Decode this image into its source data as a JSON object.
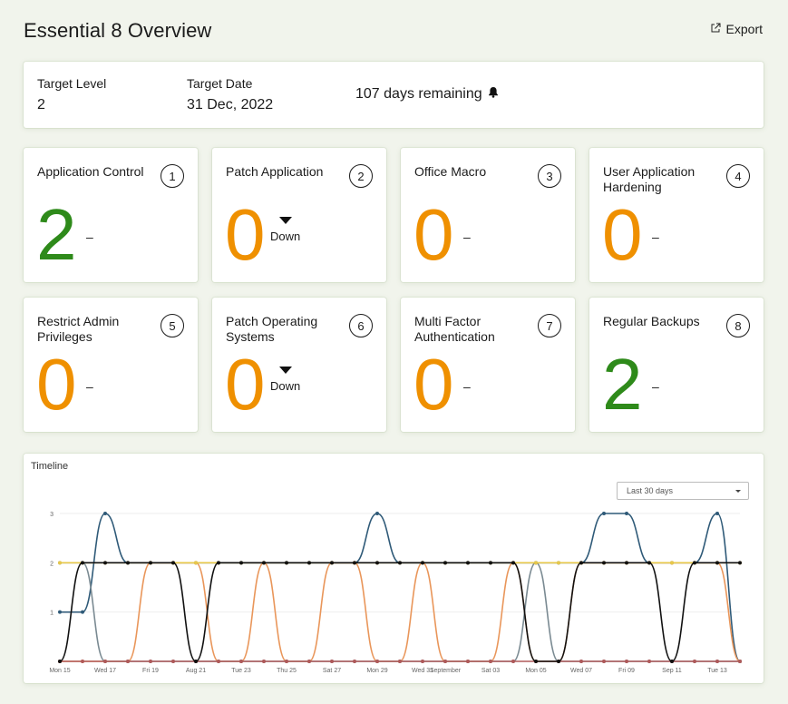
{
  "header": {
    "title": "Essential 8 Overview",
    "export_label": "Export"
  },
  "target": {
    "level_label": "Target Level",
    "level_value": "2",
    "date_label": "Target Date",
    "date_value": "31 Dec, 2022",
    "days_remaining": "107 days remaining"
  },
  "controls": [
    {
      "title": "Application Control",
      "number": "1",
      "score": "2",
      "color": "#2e8a1a",
      "trend": "–"
    },
    {
      "title": "Patch Application",
      "number": "2",
      "score": "0",
      "color": "#ef9000",
      "trend": "Down"
    },
    {
      "title": "Office Macro",
      "number": "3",
      "score": "0",
      "color": "#ef9000",
      "trend": "–"
    },
    {
      "title": "User Application Hardening",
      "number": "4",
      "score": "0",
      "color": "#ef9000",
      "trend": "–"
    },
    {
      "title": "Restrict Admin Privileges",
      "number": "5",
      "score": "0",
      "color": "#ef9000",
      "trend": "–"
    },
    {
      "title": "Patch Operating Systems",
      "number": "6",
      "score": "0",
      "color": "#ef9000",
      "trend": "Down"
    },
    {
      "title": "Multi Factor Authentication",
      "number": "7",
      "score": "0",
      "color": "#ef9000",
      "trend": "–"
    },
    {
      "title": "Regular Backups",
      "number": "8",
      "score": "2",
      "color": "#2e8a1a",
      "trend": "–"
    }
  ],
  "timeline": {
    "title": "Timeline",
    "range_label": "Last 30 days"
  },
  "chart_data": {
    "type": "line",
    "title": "Timeline",
    "xlabel": "",
    "ylabel": "",
    "ylim": [
      0,
      3
    ],
    "yticks": [
      1,
      2,
      3
    ],
    "x_tick_labels": [
      "Mon 15",
      "Wed 17",
      "Fri 19",
      "Aug 21",
      "Tue 23",
      "Thu 25",
      "Sat 27",
      "Mon 29",
      "Wed 31",
      "September",
      "Sat 03",
      "Mon 05",
      "Wed 07",
      "Fri 09",
      "Sep 11",
      "Tue 13"
    ],
    "x_tick_index": [
      0,
      2,
      4,
      6,
      8,
      10,
      12,
      14,
      16,
      17,
      19,
      21,
      23,
      25,
      27,
      29
    ],
    "grid": true,
    "legend": "none",
    "series": [
      {
        "color": "#2f5a78",
        "values": [
          1,
          1,
          3,
          2,
          2,
          2,
          2,
          2,
          2,
          2,
          2,
          2,
          2,
          2,
          3,
          2,
          2,
          2,
          2,
          2,
          2,
          2,
          2,
          2,
          3,
          3,
          2,
          2,
          2,
          3,
          0
        ]
      },
      {
        "color": "#e9965a",
        "values": [
          0,
          0,
          0,
          0,
          2,
          2,
          2,
          0,
          0,
          2,
          0,
          0,
          2,
          2,
          0,
          0,
          2,
          0,
          0,
          0,
          2,
          0,
          0,
          2,
          2,
          2,
          2,
          2,
          2,
          2,
          0
        ]
      },
      {
        "color": "#7a8a92",
        "values": [
          2,
          2,
          0,
          0,
          0,
          0,
          0,
          0,
          0,
          0,
          0,
          0,
          0,
          0,
          0,
          0,
          0,
          0,
          0,
          0,
          0,
          2,
          0,
          0,
          0,
          0,
          0,
          0,
          0,
          0,
          0
        ]
      },
      {
        "color": "#e7c84a",
        "values": [
          2,
          2,
          2,
          2,
          2,
          2,
          2,
          2,
          2,
          2,
          2,
          2,
          2,
          2,
          2,
          2,
          2,
          2,
          2,
          2,
          2,
          2,
          2,
          2,
          2,
          2,
          2,
          2,
          2,
          2,
          2
        ]
      },
      {
        "color": "#b05a5a",
        "values": [
          0,
          0,
          0,
          0,
          0,
          0,
          0,
          0,
          0,
          0,
          0,
          0,
          0,
          0,
          0,
          0,
          0,
          0,
          0,
          0,
          0,
          0,
          0,
          0,
          0,
          0,
          0,
          0,
          0,
          0,
          0
        ]
      },
      {
        "color": "#111111",
        "values": [
          0,
          2,
          2,
          2,
          2,
          2,
          0,
          2,
          2,
          2,
          2,
          2,
          2,
          2,
          2,
          2,
          2,
          2,
          2,
          2,
          2,
          0,
          0,
          2,
          2,
          2,
          2,
          0,
          2,
          2,
          2
        ]
      }
    ]
  }
}
